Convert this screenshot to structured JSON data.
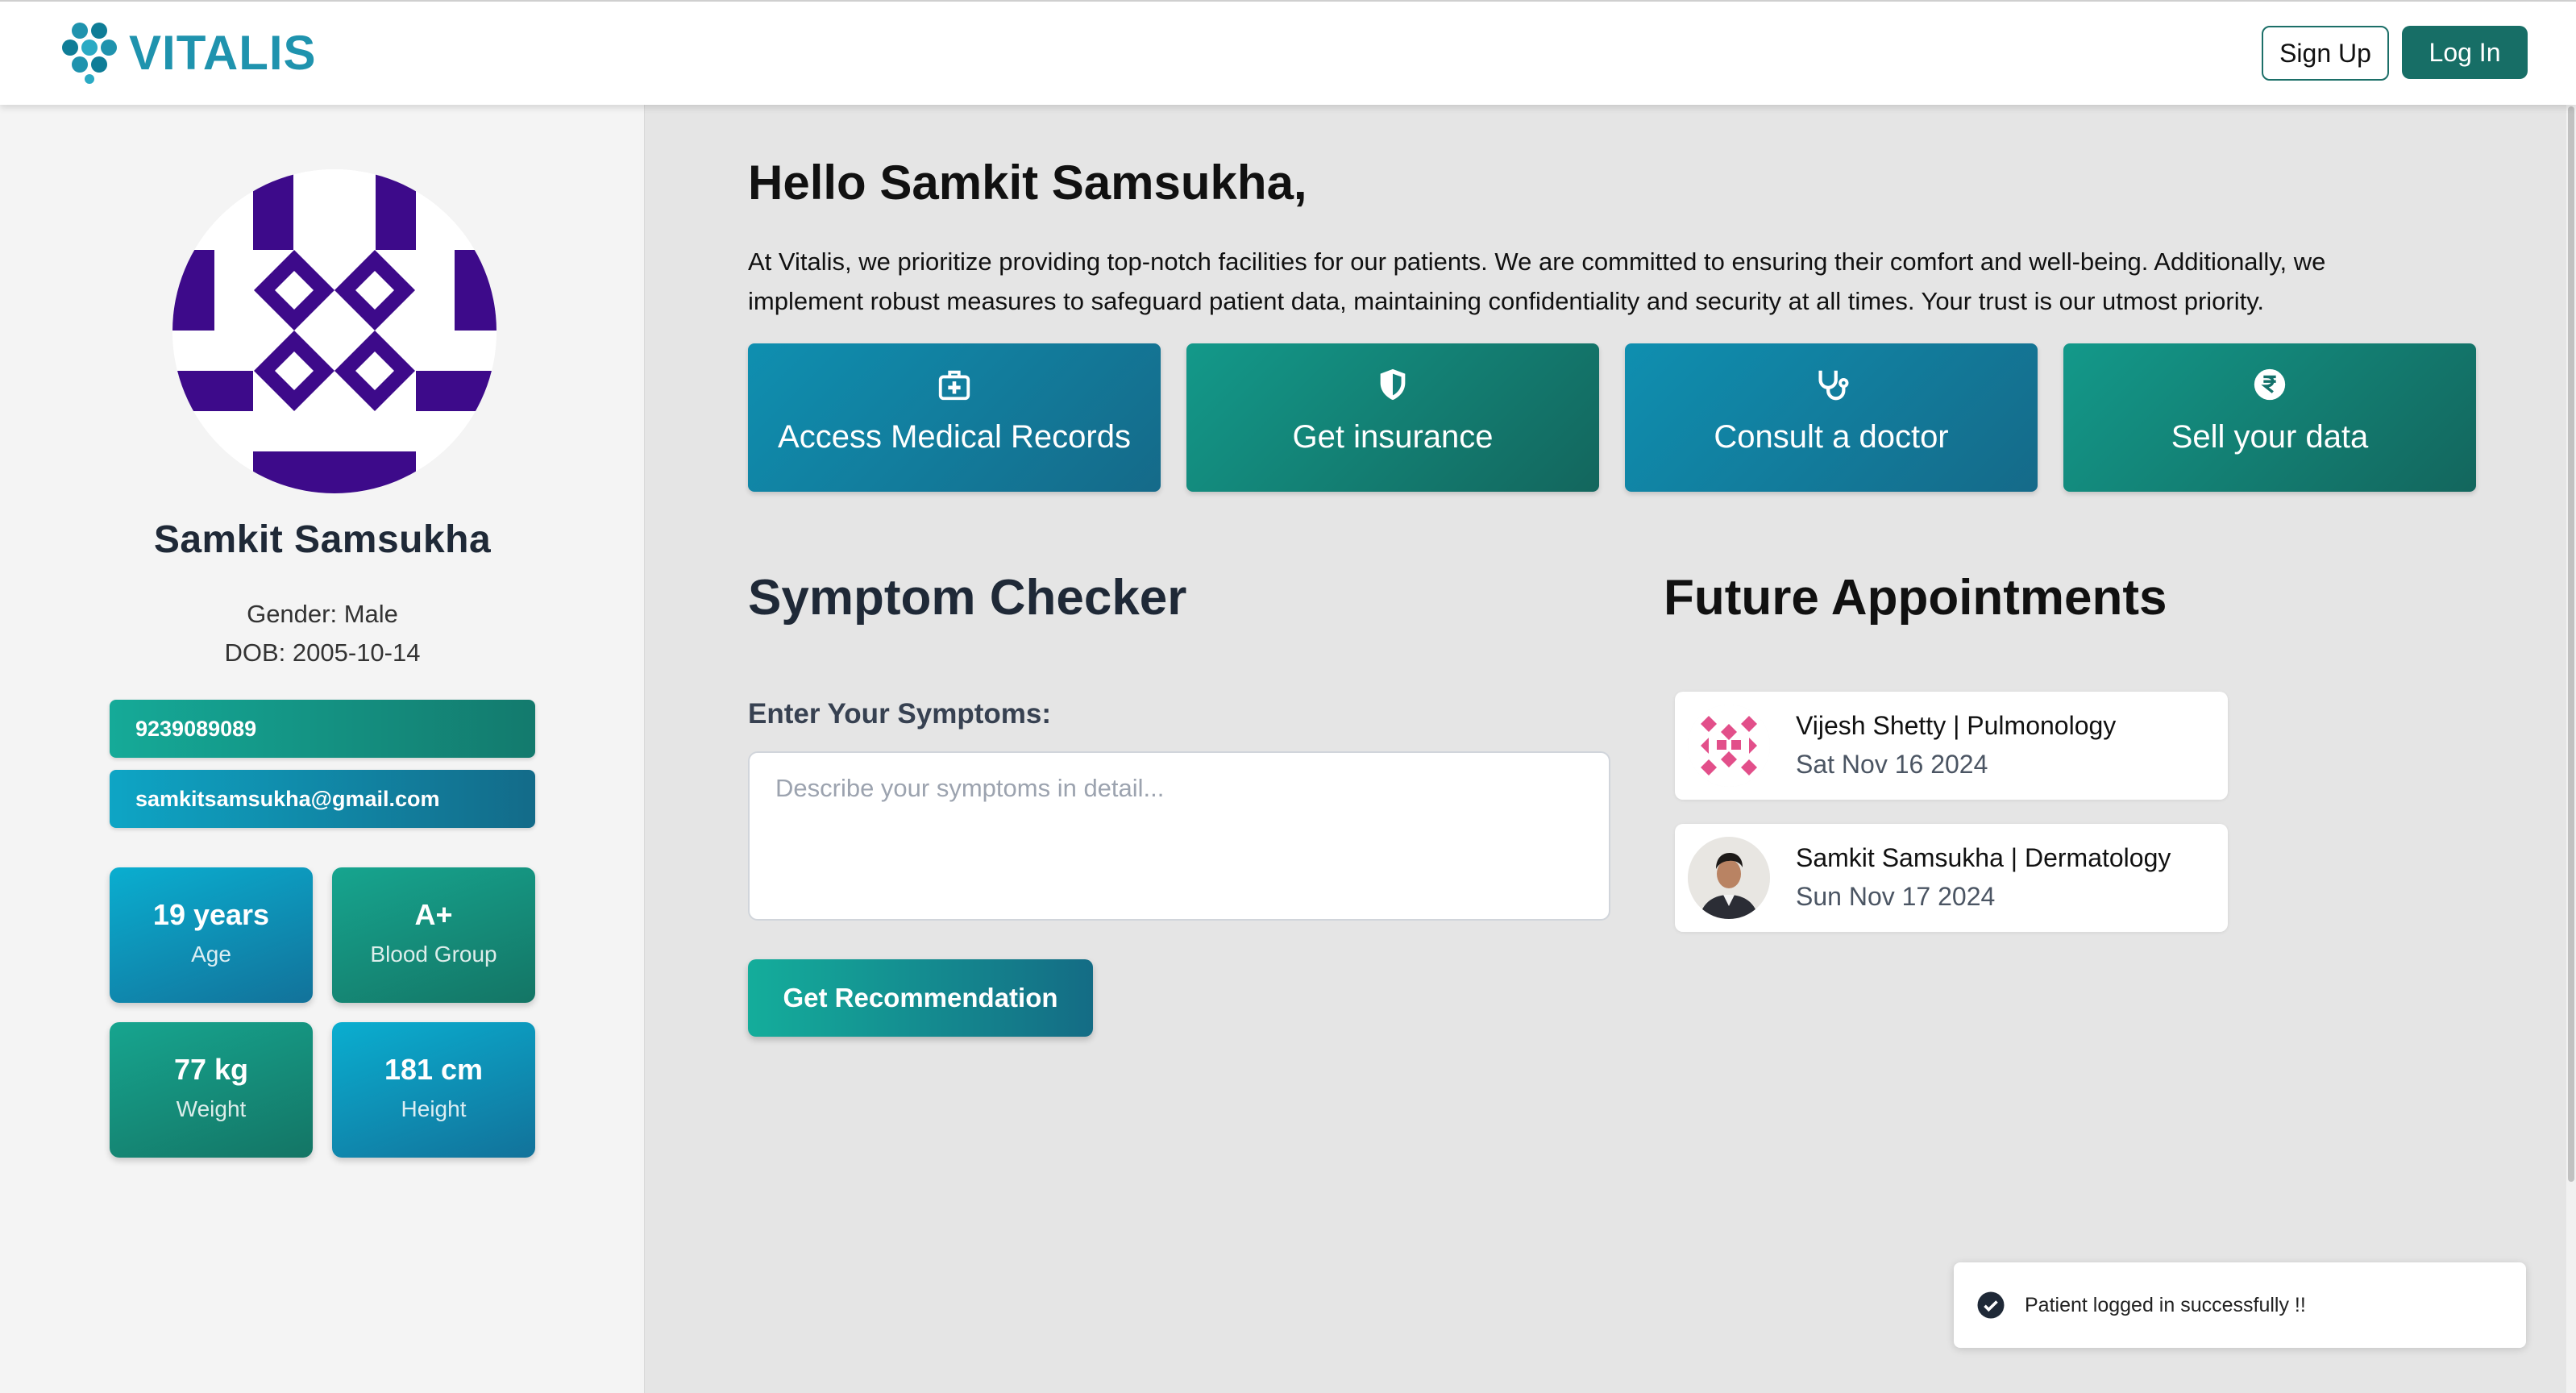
{
  "header": {
    "logo_text": "VITALIS",
    "signup_label": "Sign Up",
    "login_label": "Log In",
    "brand_color": "#1f93ae"
  },
  "profile": {
    "name": "Samkit Samsukha",
    "gender": "Gender: Male",
    "dob": "DOB: 2005-10-14",
    "phone": "9239089089",
    "email": "samkitsamsukha@gmail.com",
    "stats": [
      {
        "value": "19 years",
        "label": "Age"
      },
      {
        "value": "A+",
        "label": "Blood Group"
      },
      {
        "value": "77 kg",
        "label": "Weight"
      },
      {
        "value": "181 cm",
        "label": "Height"
      }
    ]
  },
  "main": {
    "greeting": "Hello Samkit Samsukha,",
    "intro": "At Vitalis, we prioritize providing top-notch facilities for our patients. We are committed to ensuring their comfort and well-being. Additionally, we implement robust measures to safeguard patient data, maintaining confidentiality and security at all times. Your trust is our utmost priority.",
    "actions": [
      {
        "label": "Access Medical Records",
        "icon": "medical-kit-icon"
      },
      {
        "label": "Get insurance",
        "icon": "shield-icon"
      },
      {
        "label": "Consult a doctor",
        "icon": "stethoscope-icon"
      },
      {
        "label": "Sell your data",
        "icon": "rupee-icon"
      }
    ]
  },
  "symptom_checker": {
    "title": "Symptom Checker",
    "label": "Enter Your Symptoms:",
    "placeholder": "Describe your symptoms in detail...",
    "button_label": "Get Recommendation"
  },
  "appointments": {
    "title": "Future Appointments",
    "items": [
      {
        "doctor": "Vijesh Shetty | Pulmonology",
        "date": "Sat Nov 16 2024"
      },
      {
        "doctor": "Samkit Samsukha | Dermatology",
        "date": "Sun Nov 17 2024"
      }
    ]
  },
  "toast": {
    "message": "Patient logged in successfully !!"
  }
}
